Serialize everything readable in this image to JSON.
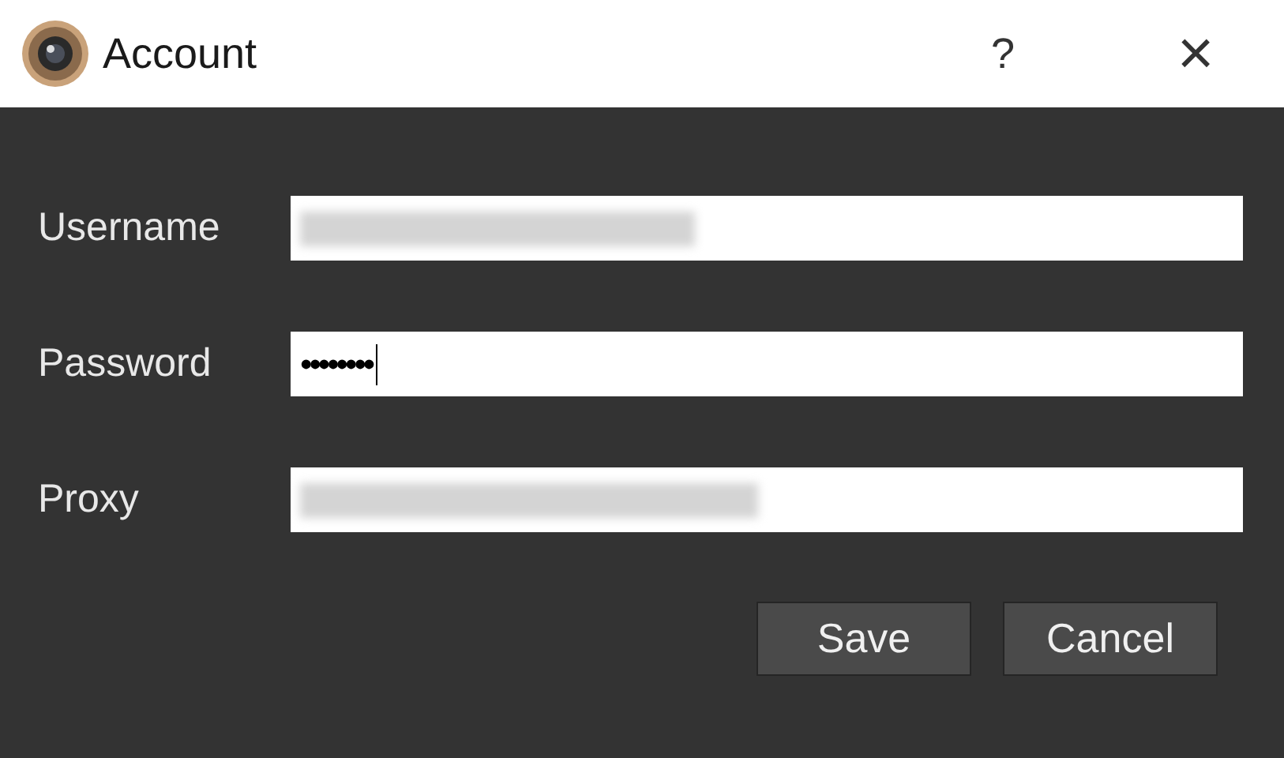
{
  "window": {
    "title": "Account",
    "help": "?",
    "close": "×"
  },
  "fields": [
    {
      "label": "Username",
      "kind": "redacted"
    },
    {
      "label": "Password",
      "kind": "password",
      "value": "••••••••"
    },
    {
      "label": "Proxy",
      "kind": "redacted"
    }
  ],
  "buttons": [
    "Save",
    "Cancel"
  ]
}
